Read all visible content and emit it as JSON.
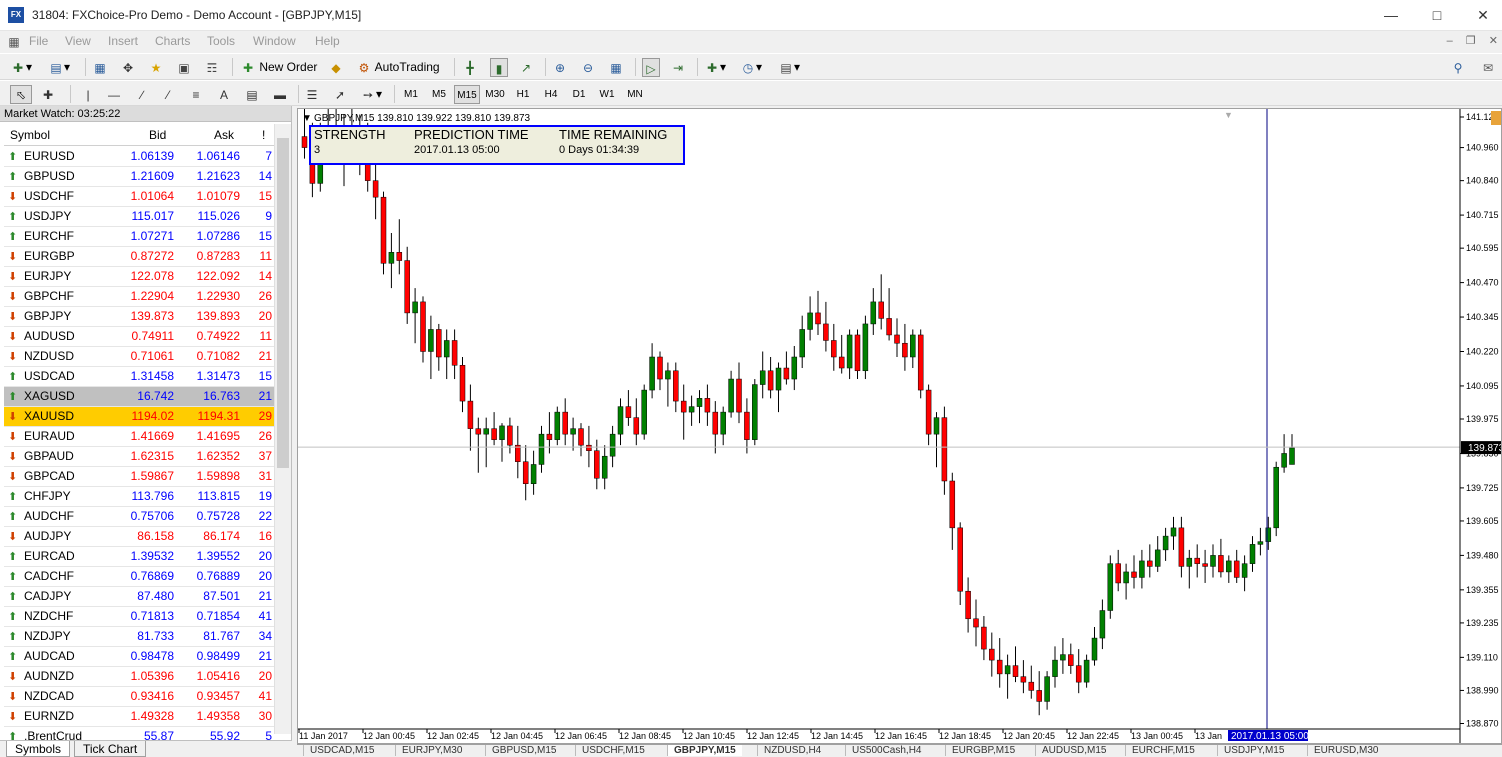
{
  "window": {
    "title": "31804: FXChoice-Pro Demo - Demo Account - [GBPJPY,M15]",
    "app_icon_label": "FX"
  },
  "menu": [
    "File",
    "View",
    "Insert",
    "Charts",
    "Tools",
    "Window",
    "Help"
  ],
  "toolbar": {
    "new_order": "New Order",
    "auto_trading": "AutoTrading"
  },
  "timeframes": [
    "M1",
    "M5",
    "M15",
    "M30",
    "H1",
    "H4",
    "D1",
    "W1",
    "MN"
  ],
  "active_timeframe": "M15",
  "market_watch": {
    "title": "Market Watch: 03:25:22",
    "columns": {
      "symbol": "Symbol",
      "bid": "Bid",
      "ask": "Ask",
      "spread": "!"
    },
    "rows": [
      {
        "symbol": "EURUSD",
        "bid": "1.06139",
        "ask": "1.06146",
        "spread": "7",
        "dir": "up"
      },
      {
        "symbol": "GBPUSD",
        "bid": "1.21609",
        "ask": "1.21623",
        "spread": "14",
        "dir": "up"
      },
      {
        "symbol": "USDCHF",
        "bid": "1.01064",
        "ask": "1.01079",
        "spread": "15",
        "dir": "down"
      },
      {
        "symbol": "USDJPY",
        "bid": "115.017",
        "ask": "115.026",
        "spread": "9",
        "dir": "up"
      },
      {
        "symbol": "EURCHF",
        "bid": "1.07271",
        "ask": "1.07286",
        "spread": "15",
        "dir": "up"
      },
      {
        "symbol": "EURGBP",
        "bid": "0.87272",
        "ask": "0.87283",
        "spread": "11",
        "dir": "down"
      },
      {
        "symbol": "EURJPY",
        "bid": "122.078",
        "ask": "122.092",
        "spread": "14",
        "dir": "down"
      },
      {
        "symbol": "GBPCHF",
        "bid": "1.22904",
        "ask": "1.22930",
        "spread": "26",
        "dir": "down"
      },
      {
        "symbol": "GBPJPY",
        "bid": "139.873",
        "ask": "139.893",
        "spread": "20",
        "dir": "down"
      },
      {
        "symbol": "AUDUSD",
        "bid": "0.74911",
        "ask": "0.74922",
        "spread": "11",
        "dir": "down"
      },
      {
        "symbol": "NZDUSD",
        "bid": "0.71061",
        "ask": "0.71082",
        "spread": "21",
        "dir": "down"
      },
      {
        "symbol": "USDCAD",
        "bid": "1.31458",
        "ask": "1.31473",
        "spread": "15",
        "dir": "up"
      },
      {
        "symbol": "XAGUSD",
        "bid": "16.742",
        "ask": "16.763",
        "spread": "21",
        "dir": "up",
        "highlight": "gray"
      },
      {
        "symbol": "XAUUSD",
        "bid": "1194.02",
        "ask": "1194.31",
        "spread": "29",
        "dir": "down",
        "highlight": "yellow"
      },
      {
        "symbol": "EURAUD",
        "bid": "1.41669",
        "ask": "1.41695",
        "spread": "26",
        "dir": "down"
      },
      {
        "symbol": "GBPAUD",
        "bid": "1.62315",
        "ask": "1.62352",
        "spread": "37",
        "dir": "down"
      },
      {
        "symbol": "GBPCAD",
        "bid": "1.59867",
        "ask": "1.59898",
        "spread": "31",
        "dir": "down"
      },
      {
        "symbol": "CHFJPY",
        "bid": "113.796",
        "ask": "113.815",
        "spread": "19",
        "dir": "up"
      },
      {
        "symbol": "AUDCHF",
        "bid": "0.75706",
        "ask": "0.75728",
        "spread": "22",
        "dir": "up"
      },
      {
        "symbol": "AUDJPY",
        "bid": "86.158",
        "ask": "86.174",
        "spread": "16",
        "dir": "down"
      },
      {
        "symbol": "EURCAD",
        "bid": "1.39532",
        "ask": "1.39552",
        "spread": "20",
        "dir": "up"
      },
      {
        "symbol": "CADCHF",
        "bid": "0.76869",
        "ask": "0.76889",
        "spread": "20",
        "dir": "up"
      },
      {
        "symbol": "CADJPY",
        "bid": "87.480",
        "ask": "87.501",
        "spread": "21",
        "dir": "up"
      },
      {
        "symbol": "NZDCHF",
        "bid": "0.71813",
        "ask": "0.71854",
        "spread": "41",
        "dir": "up"
      },
      {
        "symbol": "NZDJPY",
        "bid": "81.733",
        "ask": "81.767",
        "spread": "34",
        "dir": "up"
      },
      {
        "symbol": "AUDCAD",
        "bid": "0.98478",
        "ask": "0.98499",
        "spread": "21",
        "dir": "up"
      },
      {
        "symbol": "AUDNZD",
        "bid": "1.05396",
        "ask": "1.05416",
        "spread": "20",
        "dir": "down"
      },
      {
        "symbol": "NZDCAD",
        "bid": "0.93416",
        "ask": "0.93457",
        "spread": "41",
        "dir": "down"
      },
      {
        "symbol": "EURNZD",
        "bid": "1.49328",
        "ask": "1.49358",
        "spread": "30",
        "dir": "down"
      },
      {
        "symbol": ".BrentCrud",
        "bid": "55.87",
        "ask": "55.92",
        "spread": "5",
        "dir": "up"
      }
    ],
    "tabs": [
      "Symbols",
      "Tick Chart"
    ]
  },
  "colors": {
    "up": "#0000ff",
    "down": "#ff0000",
    "bull_candle": "#008000",
    "bear_candle": "#ff0000",
    "box_border": "#0000ff",
    "box_bg": "#eeeedd",
    "current_label_bg": "#000000",
    "time_label_bg": "#0000cc"
  },
  "chart": {
    "header": "GBPJPY,M15  139.810 139.922 139.810 139.873",
    "current_price": "139.873",
    "cursor_time": "2017.01.13 05:00",
    "indicator": {
      "headers": [
        "STRENGTH",
        "PREDICTION TIME",
        "TIME REMAINING"
      ],
      "values": [
        "3",
        "2017.01.13 05:00",
        "0 Days 01:34:39"
      ]
    }
  },
  "chart_data": {
    "type": "candlestick",
    "symbol": "GBPJPY",
    "timeframe": "M15",
    "ylim": [
      138.85,
      141.1
    ],
    "y_ticks": [
      "141.125",
      "140.960",
      "140.840",
      "140.715",
      "140.595",
      "140.470",
      "140.345",
      "140.220",
      "140.095",
      "139.975",
      "139.850",
      "139.725",
      "139.605",
      "139.480",
      "139.355",
      "139.235",
      "139.110",
      "138.990",
      "138.870"
    ],
    "x_ticks": [
      "11 Jan 2017",
      "12 Jan 00:45",
      "12 Jan 02:45",
      "12 Jan 04:45",
      "12 Jan 06:45",
      "12 Jan 08:45",
      "12 Jan 10:45",
      "12 Jan 12:45",
      "12 Jan 14:45",
      "12 Jan 16:45",
      "12 Jan 18:45",
      "12 Jan 20:45",
      "12 Jan 22:45",
      "13 Jan 00:45",
      "13 Jan"
    ],
    "candles": [
      [
        141.0,
        141.12,
        140.92,
        140.96
      ],
      [
        140.96,
        141.05,
        140.78,
        140.83
      ],
      [
        140.83,
        141.05,
        140.8,
        140.98
      ],
      [
        140.98,
        141.1,
        140.9,
        141.0
      ],
      [
        141.0,
        141.12,
        140.94,
        140.96
      ],
      [
        140.96,
        141.08,
        140.82,
        141.02
      ],
      [
        141.02,
        141.1,
        140.95,
        141.0
      ],
      [
        141.0,
        141.08,
        140.86,
        140.93
      ],
      [
        140.93,
        141.05,
        140.8,
        140.84
      ],
      [
        140.84,
        140.9,
        140.7,
        140.78
      ],
      [
        140.78,
        140.8,
        140.5,
        140.54
      ],
      [
        140.54,
        140.65,
        140.45,
        140.58
      ],
      [
        140.58,
        140.7,
        140.5,
        140.55
      ],
      [
        140.55,
        140.6,
        140.32,
        140.36
      ],
      [
        140.36,
        140.45,
        140.25,
        140.4
      ],
      [
        140.4,
        140.42,
        140.18,
        140.22
      ],
      [
        140.22,
        140.35,
        140.12,
        140.3
      ],
      [
        140.3,
        140.32,
        140.15,
        140.2
      ],
      [
        140.2,
        140.3,
        140.12,
        140.26
      ],
      [
        140.26,
        140.3,
        140.12,
        140.17
      ],
      [
        140.17,
        140.2,
        140.0,
        140.04
      ],
      [
        140.04,
        140.1,
        139.86,
        139.94
      ],
      [
        139.94,
        139.98,
        139.78,
        139.92
      ],
      [
        139.92,
        139.98,
        139.8,
        139.94
      ],
      [
        139.94,
        140.0,
        139.88,
        139.9
      ],
      [
        139.9,
        139.96,
        139.82,
        139.95
      ],
      [
        139.95,
        139.98,
        139.85,
        139.88
      ],
      [
        139.88,
        139.95,
        139.76,
        139.82
      ],
      [
        139.82,
        139.88,
        139.68,
        139.74
      ],
      [
        139.74,
        139.86,
        139.7,
        139.81
      ],
      [
        139.81,
        139.95,
        139.78,
        139.92
      ],
      [
        139.92,
        140.0,
        139.85,
        139.9
      ],
      [
        139.9,
        140.02,
        139.88,
        140.0
      ],
      [
        140.0,
        140.05,
        139.88,
        139.92
      ],
      [
        139.92,
        139.98,
        139.86,
        139.94
      ],
      [
        139.94,
        139.96,
        139.84,
        139.88
      ],
      [
        139.88,
        139.95,
        139.8,
        139.86
      ],
      [
        139.86,
        139.9,
        139.72,
        139.76
      ],
      [
        139.76,
        139.88,
        139.72,
        139.84
      ],
      [
        139.84,
        139.95,
        139.8,
        139.92
      ],
      [
        139.92,
        140.05,
        139.88,
        140.02
      ],
      [
        140.02,
        140.08,
        139.95,
        139.98
      ],
      [
        139.98,
        140.05,
        139.88,
        139.92
      ],
      [
        139.92,
        140.1,
        139.9,
        140.08
      ],
      [
        140.08,
        140.25,
        140.05,
        140.2
      ],
      [
        140.2,
        140.22,
        140.08,
        140.12
      ],
      [
        140.12,
        140.18,
        140.02,
        140.15
      ],
      [
        140.15,
        140.18,
        140.0,
        140.04
      ],
      [
        140.04,
        140.1,
        139.9,
        140.0
      ],
      [
        140.0,
        140.06,
        139.95,
        140.02
      ],
      [
        140.02,
        140.08,
        139.96,
        140.05
      ],
      [
        140.05,
        140.1,
        139.95,
        140.0
      ],
      [
        140.0,
        140.04,
        139.85,
        139.92
      ],
      [
        139.92,
        140.02,
        139.88,
        140.0
      ],
      [
        140.0,
        140.15,
        139.98,
        140.12
      ],
      [
        140.12,
        140.18,
        139.96,
        140.0
      ],
      [
        140.0,
        140.05,
        139.85,
        139.9
      ],
      [
        139.9,
        140.12,
        139.88,
        140.1
      ],
      [
        140.1,
        140.22,
        140.05,
        140.15
      ],
      [
        140.15,
        140.2,
        140.05,
        140.08
      ],
      [
        140.08,
        140.18,
        140.0,
        140.16
      ],
      [
        140.16,
        140.22,
        140.1,
        140.12
      ],
      [
        140.12,
        140.24,
        140.08,
        140.2
      ],
      [
        140.2,
        140.35,
        140.16,
        140.3
      ],
      [
        140.3,
        140.42,
        140.26,
        140.36
      ],
      [
        140.36,
        140.44,
        140.28,
        140.32
      ],
      [
        140.32,
        140.4,
        140.22,
        140.26
      ],
      [
        140.26,
        140.32,
        140.15,
        140.2
      ],
      [
        140.2,
        140.28,
        140.14,
        140.16
      ],
      [
        140.16,
        140.3,
        140.12,
        140.28
      ],
      [
        140.28,
        140.3,
        140.12,
        140.15
      ],
      [
        140.15,
        140.35,
        140.12,
        140.32
      ],
      [
        140.32,
        140.45,
        140.28,
        140.4
      ],
      [
        140.4,
        140.5,
        140.3,
        140.34
      ],
      [
        140.34,
        140.45,
        140.26,
        140.28
      ],
      [
        140.28,
        140.34,
        140.2,
        140.25
      ],
      [
        140.25,
        140.32,
        140.15,
        140.2
      ],
      [
        140.2,
        140.3,
        140.16,
        140.28
      ],
      [
        140.28,
        140.3,
        140.05,
        140.08
      ],
      [
        140.08,
        140.1,
        139.88,
        139.92
      ],
      [
        139.92,
        140.0,
        139.8,
        139.98
      ],
      [
        139.98,
        140.02,
        139.7,
        139.75
      ],
      [
        139.75,
        139.78,
        139.5,
        139.58
      ],
      [
        139.58,
        139.6,
        139.3,
        139.35
      ],
      [
        139.35,
        139.4,
        139.2,
        139.25
      ],
      [
        139.25,
        139.32,
        139.15,
        139.22
      ],
      [
        139.22,
        139.26,
        139.1,
        139.14
      ],
      [
        139.14,
        139.2,
        139.04,
        139.1
      ],
      [
        139.1,
        139.18,
        139.0,
        139.05
      ],
      [
        139.05,
        139.12,
        138.96,
        139.08
      ],
      [
        139.08,
        139.15,
        139.02,
        139.04
      ],
      [
        139.04,
        139.1,
        138.98,
        139.02
      ],
      [
        139.02,
        139.08,
        138.96,
        138.99
      ],
      [
        138.99,
        139.06,
        138.9,
        138.95
      ],
      [
        138.95,
        139.06,
        138.92,
        139.04
      ],
      [
        139.04,
        139.15,
        139.0,
        139.1
      ],
      [
        139.1,
        139.18,
        139.05,
        139.12
      ],
      [
        139.12,
        139.16,
        139.05,
        139.08
      ],
      [
        139.08,
        139.14,
        138.98,
        139.02
      ],
      [
        139.02,
        139.12,
        139.0,
        139.1
      ],
      [
        139.1,
        139.22,
        139.08,
        139.18
      ],
      [
        139.18,
        139.32,
        139.14,
        139.28
      ],
      [
        139.28,
        139.48,
        139.25,
        139.45
      ],
      [
        139.45,
        139.5,
        139.35,
        139.38
      ],
      [
        139.38,
        139.45,
        139.32,
        139.42
      ],
      [
        139.42,
        139.48,
        139.36,
        139.4
      ],
      [
        139.4,
        139.5,
        139.36,
        139.46
      ],
      [
        139.46,
        139.52,
        139.4,
        139.44
      ],
      [
        139.44,
        139.55,
        139.42,
        139.5
      ],
      [
        139.5,
        139.58,
        139.46,
        139.55
      ],
      [
        139.55,
        139.62,
        139.5,
        139.58
      ],
      [
        139.58,
        139.62,
        139.4,
        139.44
      ],
      [
        139.44,
        139.5,
        139.36,
        139.47
      ],
      [
        139.47,
        139.52,
        139.4,
        139.45
      ],
      [
        139.45,
        139.5,
        139.38,
        139.44
      ],
      [
        139.44,
        139.52,
        139.4,
        139.48
      ],
      [
        139.48,
        139.54,
        139.4,
        139.42
      ],
      [
        139.42,
        139.48,
        139.38,
        139.46
      ],
      [
        139.46,
        139.5,
        139.38,
        139.4
      ],
      [
        139.4,
        139.48,
        139.35,
        139.45
      ],
      [
        139.45,
        139.55,
        139.42,
        139.52
      ],
      [
        139.52,
        139.58,
        139.48,
        139.53
      ],
      [
        139.53,
        139.62,
        139.5,
        139.58
      ],
      [
        139.58,
        139.82,
        139.55,
        139.8
      ],
      [
        139.8,
        139.92,
        139.78,
        139.85
      ],
      [
        139.81,
        139.92,
        139.81,
        139.87
      ]
    ]
  },
  "chart_tabs": [
    "USDCAD,M15",
    "EURJPY,M30",
    "GBPUSD,M15",
    "USDCHF,M15",
    "GBPJPY,M15",
    "NZDUSD,H4",
    "US500Cash,H4",
    "EURGBP,M15",
    "AUDUSD,M15",
    "EURCHF,M15",
    "USDJPY,M15",
    "EURUSD,M30"
  ],
  "active_chart_tab": "GBPJPY,M15"
}
